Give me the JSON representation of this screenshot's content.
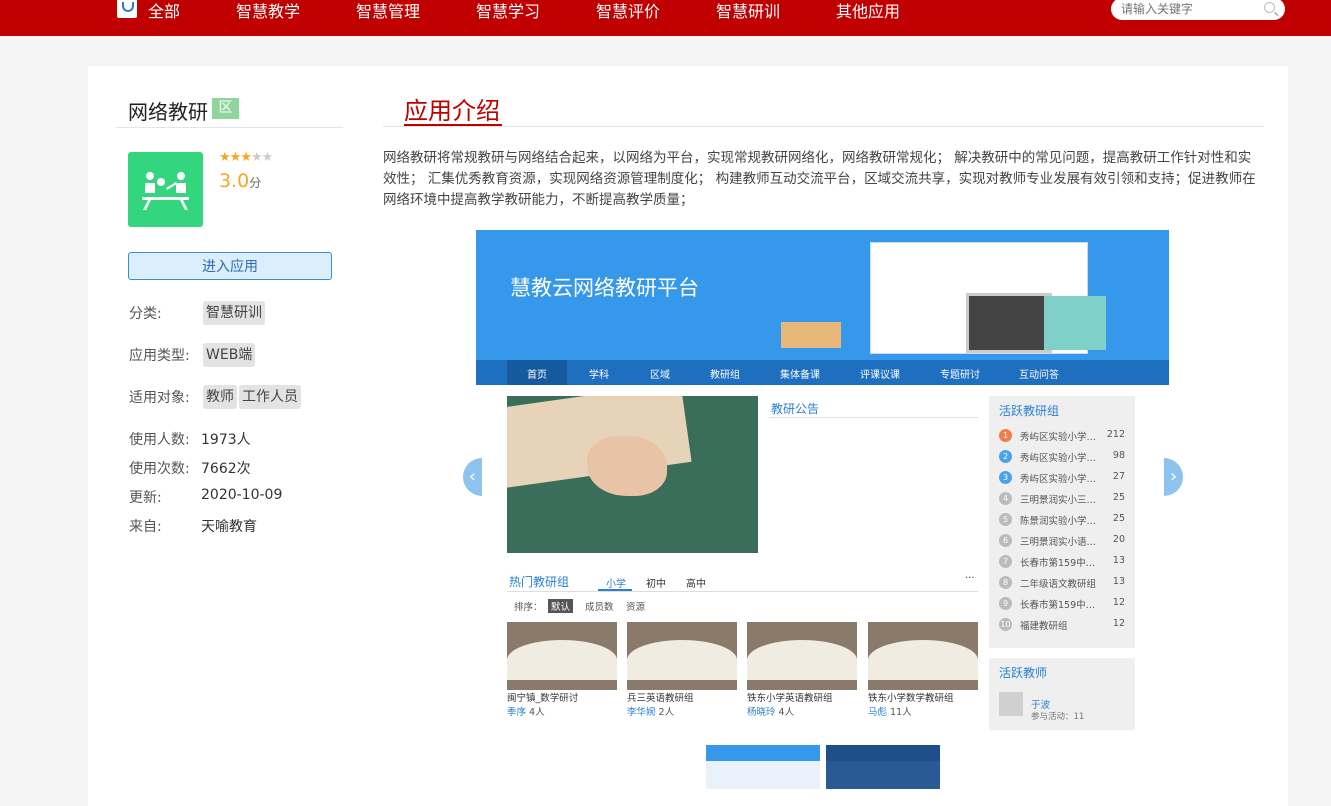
{
  "nav": {
    "items": [
      "全部",
      "智慧教学",
      "智慧管理",
      "智慧学习",
      "智慧评价",
      "智慧研训",
      "其他应用"
    ],
    "search_placeholder": "请输入关键字"
  },
  "app": {
    "name": "网络教研",
    "badge": "区",
    "rating_value": 3,
    "rating_max": 5,
    "score": "3.0",
    "score_unit": "分",
    "enter_label": "进入应用",
    "category_label": "分类:",
    "category_tags": [
      "智慧研训"
    ],
    "type_label": "应用类型:",
    "type_tags": [
      "WEB端"
    ],
    "audience_label": "适用对象:",
    "audience_tags": [
      "教师",
      "工作人员"
    ],
    "users_label": "使用人数:",
    "users_value": "1973人",
    "uses_label": "使用次数:",
    "uses_value": "7662次",
    "updated_label": "更新:",
    "updated_value": "2020-10-09",
    "source_label": "来自:",
    "source_value": "天喻教育"
  },
  "intro": {
    "title": "应用介绍",
    "text": "网络教研将常规教研与网络结合起来，以网络为平台，实现常规教研网络化，网络教研常规化； 解决教研中的常见问题，提高教研工作针对性和实效性； 汇集优秀教育资源，实现网络资源管理制度化； 构建教师互动交流平台，区域交流共享，实现对教师专业发展有效引领和支持；促进教师在网络环境中提高教学教研能力，不断提高教学质量；"
  },
  "screenshot": {
    "title": "慧教云网络教研平台",
    "nav": [
      "首页",
      "学科",
      "区域",
      "教研组",
      "集体备课",
      "评课议课",
      "专题研讨",
      "互动问答"
    ],
    "announcement_title": "教研公告",
    "active_groups_title": "活跃教研组",
    "active_groups": [
      {
        "rank": "1",
        "name": "秀屿区实验小学语...",
        "count": "212"
      },
      {
        "rank": "2",
        "name": "秀屿区实验小学数...",
        "count": "98"
      },
      {
        "rank": "3",
        "name": "秀屿区实验小学综...",
        "count": "27"
      },
      {
        "rank": "4",
        "name": "三明景润实小三年...",
        "count": "25"
      },
      {
        "rank": "5",
        "name": "陈景润实验小学英...",
        "count": "25"
      },
      {
        "rank": "6",
        "name": "三明景润实小语文...",
        "count": "20"
      },
      {
        "rank": "7",
        "name": "长春市第159中学...",
        "count": "13"
      },
      {
        "rank": "8",
        "name": "二年级语文教研组",
        "count": "13"
      },
      {
        "rank": "9",
        "name": "长春市第159中学...",
        "count": "12"
      },
      {
        "rank": "10",
        "name": "福建教研组",
        "count": "12"
      }
    ],
    "active_teachers_title": "活跃教师",
    "teacher_name": "于波",
    "teacher_activity": "参与活动：11",
    "hot_groups_title": "热门教研组",
    "hot_tabs": [
      "小学",
      "初中",
      "高中"
    ],
    "more": "···",
    "sort_label": "排序：",
    "sort_options": [
      "默认",
      "成员数",
      "资源"
    ],
    "groups": [
      {
        "name": "闽宁镇_数学研讨",
        "lead": "季序",
        "members": "4人"
      },
      {
        "name": "兵三英语教研组",
        "lead": "李华婉",
        "members": "2人"
      },
      {
        "name": "铁东小学英语教研组",
        "lead": "杨晓玲",
        "members": "4人"
      },
      {
        "name": "铁东小学数学教研组",
        "lead": "马彪",
        "members": "11人"
      }
    ]
  },
  "colors": {
    "brand_red": "#c00000",
    "accent_blue": "#2a7fd4",
    "star": "#f5a623",
    "app_icon": "#33d67d"
  }
}
